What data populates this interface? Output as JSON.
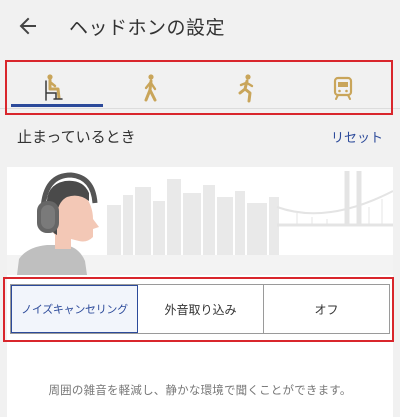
{
  "header": {
    "title": "ヘッドホンの設定",
    "back_icon": "arrow-left-icon"
  },
  "activity_tabs": [
    {
      "icon": "sitting-person-icon",
      "selected": true
    },
    {
      "icon": "walking-person-icon",
      "selected": false
    },
    {
      "icon": "running-person-icon",
      "selected": false
    },
    {
      "icon": "train-icon",
      "selected": false
    }
  ],
  "section": {
    "title": "止まっているとき",
    "reset_label": "リセット"
  },
  "modes": {
    "options": [
      "ノイズキャンセリング",
      "外音取り込み",
      "オフ"
    ],
    "selected": "ノイズキャンセリング"
  },
  "description": "周囲の雑音を軽減し、静かな環境で聞くことができます。",
  "colors": {
    "accent": "#2c4a9a",
    "highlight_border": "#d9262c",
    "background": "#f1f1f1",
    "tab_icon": "#c9a55a"
  }
}
